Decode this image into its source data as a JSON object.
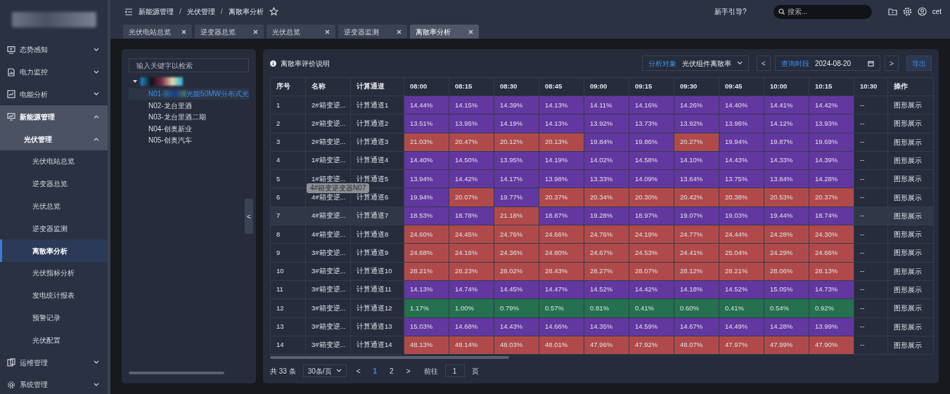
{
  "header": {
    "breadcrumb": [
      "新能源管理",
      "光伏管理",
      "离散率分析"
    ],
    "separator": "/",
    "guide": "新手引导?",
    "search": {
      "placeholder": "搜索..."
    },
    "user": "cet"
  },
  "tabs": [
    {
      "label": "光伏电站总览",
      "selected": false
    },
    {
      "label": "逆变器总览",
      "selected": false
    },
    {
      "label": "光伏总览",
      "selected": false
    },
    {
      "label": "逆变器监测",
      "selected": false
    },
    {
      "label": "离散率分析",
      "selected": true
    }
  ],
  "sidebar": {
    "items": [
      {
        "label": "态势感知",
        "expanded": false
      },
      {
        "label": "电力监控",
        "expanded": false
      },
      {
        "label": "电能分析",
        "expanded": false
      },
      {
        "label": "新能源管理",
        "expanded": true,
        "children": [
          {
            "label": "光伏管理",
            "expanded": true,
            "children": [
              {
                "label": "光伏电站总览",
                "selected": false
              },
              {
                "label": "逆变器总览",
                "selected": false
              },
              {
                "label": "光伏总览",
                "selected": false
              },
              {
                "label": "逆变器监测",
                "selected": false
              },
              {
                "label": "离散率分析",
                "selected": true
              },
              {
                "label": "光伏指标分析",
                "selected": false
              },
              {
                "label": "发电统计报表",
                "selected": false
              },
              {
                "label": "预警记录",
                "selected": false
              },
              {
                "label": "光伏配置",
                "selected": false
              }
            ]
          }
        ]
      },
      {
        "label": "运维管理",
        "expanded": false
      },
      {
        "label": "系统管理",
        "expanded": false
      }
    ]
  },
  "tree": {
    "search": {
      "placeholder": "输入关键字以检索"
    },
    "collapse": "<",
    "root": {
      "expanded": true,
      "children": [
        {
          "label": "N01-",
          "label_after_blur": "光能50MW分布式光",
          "selected": true
        },
        {
          "label": "N02-龙台里酒",
          "selected": false
        },
        {
          "label": "N03-龙台里酒二期",
          "selected": false
        },
        {
          "label": "N04-创奥新业",
          "selected": false
        },
        {
          "label": "N05-创奥汽车",
          "selected": false
        }
      ]
    }
  },
  "toolbar": {
    "info": "离散率评价说明",
    "object": {
      "label": "分析对象",
      "value": "光伏组件离散率"
    },
    "prev": "<",
    "period": {
      "label": "查询时段",
      "value": "2024-08-20"
    },
    "next": ">",
    "export": "导出"
  },
  "table": {
    "columns": [
      "序号",
      "名称",
      "计算通道",
      "08:00",
      "08:15",
      "08:30",
      "08:45",
      "09:00",
      "09:15",
      "09:30",
      "09:45",
      "10:00",
      "10:15",
      "10:30",
      "操作"
    ],
    "rows": [
      {
        "hovered": false,
        "cells": [
          {
            "kind": "text",
            "text": "1"
          },
          {
            "kind": "text",
            "text": "2#箱变逆..."
          },
          {
            "kind": "text",
            "text": "计算通道1"
          },
          {
            "kind": "value",
            "text": "14.44%",
            "color": "#6337a0"
          },
          {
            "kind": "value",
            "text": "14.15%",
            "color": "#6337a0"
          },
          {
            "kind": "value",
            "text": "14.39%",
            "color": "#6337a0"
          },
          {
            "kind": "value",
            "text": "14.13%",
            "color": "#6337a0"
          },
          {
            "kind": "value",
            "text": "14.11%",
            "color": "#6337a0"
          },
          {
            "kind": "value",
            "text": "14.16%",
            "color": "#6337a0"
          },
          {
            "kind": "value",
            "text": "14.26%",
            "color": "#6337a0"
          },
          {
            "kind": "value",
            "text": "14.40%",
            "color": "#6337a0"
          },
          {
            "kind": "value",
            "text": "14.41%",
            "color": "#6337a0"
          },
          {
            "kind": "value",
            "text": "14.42%",
            "color": "#6337a0"
          },
          {
            "kind": "text",
            "text": "--"
          },
          {
            "kind": "link",
            "text": "图形展示"
          }
        ]
      },
      {
        "hovered": false,
        "cells": [
          {
            "kind": "text",
            "text": "2"
          },
          {
            "kind": "text",
            "text": "2#箱变逆..."
          },
          {
            "kind": "text",
            "text": "计算通道2"
          },
          {
            "kind": "value",
            "text": "13.51%",
            "color": "#6337a0"
          },
          {
            "kind": "value",
            "text": "13.95%",
            "color": "#6337a0"
          },
          {
            "kind": "value",
            "text": "14.19%",
            "color": "#6337a0"
          },
          {
            "kind": "value",
            "text": "14.13%",
            "color": "#6337a0"
          },
          {
            "kind": "value",
            "text": "13.92%",
            "color": "#6337a0"
          },
          {
            "kind": "value",
            "text": "13.73%",
            "color": "#6337a0"
          },
          {
            "kind": "value",
            "text": "13.92%",
            "color": "#6337a0"
          },
          {
            "kind": "value",
            "text": "13.96%",
            "color": "#6337a0"
          },
          {
            "kind": "value",
            "text": "14.12%",
            "color": "#6337a0"
          },
          {
            "kind": "value",
            "text": "13.93%",
            "color": "#6337a0"
          },
          {
            "kind": "text",
            "text": "--"
          },
          {
            "kind": "link",
            "text": "图形展示"
          }
        ]
      },
      {
        "hovered": false,
        "cells": [
          {
            "kind": "text",
            "text": "3"
          },
          {
            "kind": "text",
            "text": "2#箱变逆..."
          },
          {
            "kind": "text",
            "text": "计算通道3"
          },
          {
            "kind": "value",
            "text": "21.03%",
            "color": "#b04a4a"
          },
          {
            "kind": "value",
            "text": "20.47%",
            "color": "#b04a4a"
          },
          {
            "kind": "value",
            "text": "20.12%",
            "color": "#b04a4a"
          },
          {
            "kind": "value",
            "text": "20.13%",
            "color": "#b04a4a"
          },
          {
            "kind": "value",
            "text": "19.84%",
            "color": "#6337a0"
          },
          {
            "kind": "value",
            "text": "19.86%",
            "color": "#6337a0"
          },
          {
            "kind": "value",
            "text": "20.27%",
            "color": "#b04a4a"
          },
          {
            "kind": "value",
            "text": "19.94%",
            "color": "#6337a0"
          },
          {
            "kind": "value",
            "text": "19.87%",
            "color": "#6337a0"
          },
          {
            "kind": "value",
            "text": "19.69%",
            "color": "#6337a0"
          },
          {
            "kind": "text",
            "text": "--"
          },
          {
            "kind": "link",
            "text": "图形展示"
          }
        ]
      },
      {
        "hovered": false,
        "cells": [
          {
            "kind": "text",
            "text": "4"
          },
          {
            "kind": "text",
            "text": "1#箱变逆..."
          },
          {
            "kind": "text",
            "text": "计算通道4"
          },
          {
            "kind": "value",
            "text": "14.40%",
            "color": "#6337a0"
          },
          {
            "kind": "value",
            "text": "14.50%",
            "color": "#6337a0"
          },
          {
            "kind": "value",
            "text": "13.95%",
            "color": "#6337a0"
          },
          {
            "kind": "value",
            "text": "14.19%",
            "color": "#6337a0"
          },
          {
            "kind": "value",
            "text": "14.02%",
            "color": "#6337a0"
          },
          {
            "kind": "value",
            "text": "14.58%",
            "color": "#6337a0"
          },
          {
            "kind": "value",
            "text": "14.10%",
            "color": "#6337a0"
          },
          {
            "kind": "value",
            "text": "14.43%",
            "color": "#6337a0"
          },
          {
            "kind": "value",
            "text": "14.33%",
            "color": "#6337a0"
          },
          {
            "kind": "value",
            "text": "14.39%",
            "color": "#6337a0"
          },
          {
            "kind": "text",
            "text": "--"
          },
          {
            "kind": "link",
            "text": "图形展示"
          }
        ]
      },
      {
        "hovered": false,
        "cells": [
          {
            "kind": "text",
            "text": "5"
          },
          {
            "kind": "text",
            "text": "1#箱变逆..."
          },
          {
            "kind": "text",
            "text": "计算通道5"
          },
          {
            "kind": "value",
            "text": "13.94%",
            "color": "#6337a0"
          },
          {
            "kind": "value",
            "text": "14.42%",
            "color": "#6337a0"
          },
          {
            "kind": "value",
            "text": "14.17%",
            "color": "#6337a0"
          },
          {
            "kind": "value",
            "text": "13.98%",
            "color": "#6337a0"
          },
          {
            "kind": "value",
            "text": "13.33%",
            "color": "#6337a0"
          },
          {
            "kind": "value",
            "text": "14.09%",
            "color": "#6337a0"
          },
          {
            "kind": "value",
            "text": "13.64%",
            "color": "#6337a0"
          },
          {
            "kind": "value",
            "text": "13.75%",
            "color": "#6337a0"
          },
          {
            "kind": "value",
            "text": "13.84%",
            "color": "#6337a0"
          },
          {
            "kind": "value",
            "text": "14.28%",
            "color": "#6337a0"
          },
          {
            "kind": "text",
            "text": "--"
          },
          {
            "kind": "link",
            "text": "图形展示"
          }
        ]
      },
      {
        "hovered": false,
        "tooltip": "4#箱变逆变器N07",
        "cells": [
          {
            "kind": "text",
            "text": "6"
          },
          {
            "kind": "text",
            "text": "4#箱变逆..."
          },
          {
            "kind": "text",
            "text": "计算通道6"
          },
          {
            "kind": "value",
            "text": "19.94%",
            "color": "#6337a0"
          },
          {
            "kind": "value",
            "text": "20.07%",
            "color": "#b04a4a"
          },
          {
            "kind": "value",
            "text": "19.77%",
            "color": "#6337a0"
          },
          {
            "kind": "value",
            "text": "20.37%",
            "color": "#b04a4a"
          },
          {
            "kind": "value",
            "text": "20.34%",
            "color": "#b04a4a"
          },
          {
            "kind": "value",
            "text": "20.30%",
            "color": "#b04a4a"
          },
          {
            "kind": "value",
            "text": "20.42%",
            "color": "#b04a4a"
          },
          {
            "kind": "value",
            "text": "20.38%",
            "color": "#b04a4a"
          },
          {
            "kind": "value",
            "text": "20.53%",
            "color": "#b04a4a"
          },
          {
            "kind": "value",
            "text": "20.37%",
            "color": "#b04a4a"
          },
          {
            "kind": "text",
            "text": "--"
          },
          {
            "kind": "link",
            "text": "图形展示"
          }
        ]
      },
      {
        "hovered": true,
        "cells": [
          {
            "kind": "text",
            "text": "7"
          },
          {
            "kind": "text",
            "text": "4#箱变逆..."
          },
          {
            "kind": "text",
            "text": "计算通道7"
          },
          {
            "kind": "value",
            "text": "18.53%",
            "color": "#6337a0"
          },
          {
            "kind": "value",
            "text": "18.78%",
            "color": "#6337a0"
          },
          {
            "kind": "value",
            "text": "21.18%",
            "color": "#b04a4a"
          },
          {
            "kind": "value",
            "text": "18.87%",
            "color": "#6337a0"
          },
          {
            "kind": "value",
            "text": "19.28%",
            "color": "#6337a0"
          },
          {
            "kind": "value",
            "text": "18.97%",
            "color": "#6337a0"
          },
          {
            "kind": "value",
            "text": "19.07%",
            "color": "#6337a0"
          },
          {
            "kind": "value",
            "text": "19.03%",
            "color": "#6337a0"
          },
          {
            "kind": "value",
            "text": "19.44%",
            "color": "#6337a0"
          },
          {
            "kind": "value",
            "text": "18.74%",
            "color": "#6337a0"
          },
          {
            "kind": "text",
            "text": "--"
          },
          {
            "kind": "link",
            "text": "图形展示"
          }
        ]
      },
      {
        "hovered": false,
        "cells": [
          {
            "kind": "text",
            "text": "8"
          },
          {
            "kind": "text",
            "text": "4#箱变逆..."
          },
          {
            "kind": "text",
            "text": "计算通道8"
          },
          {
            "kind": "value",
            "text": "24.60%",
            "color": "#b04a4a"
          },
          {
            "kind": "value",
            "text": "24.45%",
            "color": "#b04a4a"
          },
          {
            "kind": "value",
            "text": "24.76%",
            "color": "#b04a4a"
          },
          {
            "kind": "value",
            "text": "24.66%",
            "color": "#b04a4a"
          },
          {
            "kind": "value",
            "text": "24.76%",
            "color": "#b04a4a"
          },
          {
            "kind": "value",
            "text": "24.19%",
            "color": "#b04a4a"
          },
          {
            "kind": "value",
            "text": "24.77%",
            "color": "#b04a4a"
          },
          {
            "kind": "value",
            "text": "24.44%",
            "color": "#b04a4a"
          },
          {
            "kind": "value",
            "text": "24.28%",
            "color": "#b04a4a"
          },
          {
            "kind": "value",
            "text": "24.30%",
            "color": "#b04a4a"
          },
          {
            "kind": "text",
            "text": "--"
          },
          {
            "kind": "link",
            "text": "图形展示"
          }
        ]
      },
      {
        "hovered": false,
        "cells": [
          {
            "kind": "text",
            "text": "9"
          },
          {
            "kind": "text",
            "text": "3#箱变逆..."
          },
          {
            "kind": "text",
            "text": "计算通道9"
          },
          {
            "kind": "value",
            "text": "24.68%",
            "color": "#b04a4a"
          },
          {
            "kind": "value",
            "text": "24.16%",
            "color": "#b04a4a"
          },
          {
            "kind": "value",
            "text": "24.36%",
            "color": "#b04a4a"
          },
          {
            "kind": "value",
            "text": "24.80%",
            "color": "#b04a4a"
          },
          {
            "kind": "value",
            "text": "24.67%",
            "color": "#b04a4a"
          },
          {
            "kind": "value",
            "text": "24.53%",
            "color": "#b04a4a"
          },
          {
            "kind": "value",
            "text": "24.41%",
            "color": "#b04a4a"
          },
          {
            "kind": "value",
            "text": "25.04%",
            "color": "#b04a4a"
          },
          {
            "kind": "value",
            "text": "24.29%",
            "color": "#b04a4a"
          },
          {
            "kind": "value",
            "text": "24.66%",
            "color": "#b04a4a"
          },
          {
            "kind": "text",
            "text": "--"
          },
          {
            "kind": "link",
            "text": "图形展示"
          }
        ]
      },
      {
        "hovered": false,
        "cells": [
          {
            "kind": "text",
            "text": "10"
          },
          {
            "kind": "text",
            "text": "3#箱变逆..."
          },
          {
            "kind": "text",
            "text": "计算通道10"
          },
          {
            "kind": "value",
            "text": "28.21%",
            "color": "#b04a4a"
          },
          {
            "kind": "value",
            "text": "28.23%",
            "color": "#b04a4a"
          },
          {
            "kind": "value",
            "text": "28.02%",
            "color": "#b04a4a"
          },
          {
            "kind": "value",
            "text": "28.43%",
            "color": "#b04a4a"
          },
          {
            "kind": "value",
            "text": "28.27%",
            "color": "#b04a4a"
          },
          {
            "kind": "value",
            "text": "28.07%",
            "color": "#b04a4a"
          },
          {
            "kind": "value",
            "text": "28.12%",
            "color": "#b04a4a"
          },
          {
            "kind": "value",
            "text": "28.21%",
            "color": "#b04a4a"
          },
          {
            "kind": "value",
            "text": "28.06%",
            "color": "#b04a4a"
          },
          {
            "kind": "value",
            "text": "28.13%",
            "color": "#b04a4a"
          },
          {
            "kind": "text",
            "text": "--"
          },
          {
            "kind": "link",
            "text": "图形展示"
          }
        ]
      },
      {
        "hovered": false,
        "cells": [
          {
            "kind": "text",
            "text": "11"
          },
          {
            "kind": "text",
            "text": "3#箱变逆..."
          },
          {
            "kind": "text",
            "text": "计算通道11"
          },
          {
            "kind": "value",
            "text": "14.13%",
            "color": "#6337a0"
          },
          {
            "kind": "value",
            "text": "14.74%",
            "color": "#6337a0"
          },
          {
            "kind": "value",
            "text": "14.45%",
            "color": "#6337a0"
          },
          {
            "kind": "value",
            "text": "14.47%",
            "color": "#6337a0"
          },
          {
            "kind": "value",
            "text": "14.52%",
            "color": "#6337a0"
          },
          {
            "kind": "value",
            "text": "14.42%",
            "color": "#6337a0"
          },
          {
            "kind": "value",
            "text": "14.18%",
            "color": "#6337a0"
          },
          {
            "kind": "value",
            "text": "14.52%",
            "color": "#6337a0"
          },
          {
            "kind": "value",
            "text": "15.05%",
            "color": "#6337a0"
          },
          {
            "kind": "value",
            "text": "14.73%",
            "color": "#6337a0"
          },
          {
            "kind": "text",
            "text": "--"
          },
          {
            "kind": "link",
            "text": "图形展示"
          }
        ]
      },
      {
        "hovered": false,
        "cells": [
          {
            "kind": "text",
            "text": "12"
          },
          {
            "kind": "text",
            "text": "3#箱变逆..."
          },
          {
            "kind": "text",
            "text": "计算通道12"
          },
          {
            "kind": "value",
            "text": "1.17%",
            "color": "#24704f"
          },
          {
            "kind": "value",
            "text": "1.00%",
            "color": "#24704f"
          },
          {
            "kind": "value",
            "text": "0.79%",
            "color": "#24704f"
          },
          {
            "kind": "value",
            "text": "0.57%",
            "color": "#24704f"
          },
          {
            "kind": "value",
            "text": "0.81%",
            "color": "#24704f"
          },
          {
            "kind": "value",
            "text": "0.41%",
            "color": "#24704f"
          },
          {
            "kind": "value",
            "text": "0.60%",
            "color": "#24704f"
          },
          {
            "kind": "value",
            "text": "0.41%",
            "color": "#24704f"
          },
          {
            "kind": "value",
            "text": "0.54%",
            "color": "#24704f"
          },
          {
            "kind": "value",
            "text": "0.92%",
            "color": "#24704f"
          },
          {
            "kind": "text",
            "text": "--"
          },
          {
            "kind": "link",
            "text": "图形展示"
          }
        ]
      },
      {
        "hovered": false,
        "cells": [
          {
            "kind": "text",
            "text": "13"
          },
          {
            "kind": "text",
            "text": "3#箱变逆..."
          },
          {
            "kind": "text",
            "text": "计算通道13"
          },
          {
            "kind": "value",
            "text": "15.03%",
            "color": "#6337a0"
          },
          {
            "kind": "value",
            "text": "14.68%",
            "color": "#6337a0"
          },
          {
            "kind": "value",
            "text": "14.43%",
            "color": "#6337a0"
          },
          {
            "kind": "value",
            "text": "14.66%",
            "color": "#6337a0"
          },
          {
            "kind": "value",
            "text": "14.35%",
            "color": "#6337a0"
          },
          {
            "kind": "value",
            "text": "14.59%",
            "color": "#6337a0"
          },
          {
            "kind": "value",
            "text": "14.67%",
            "color": "#6337a0"
          },
          {
            "kind": "value",
            "text": "14.49%",
            "color": "#6337a0"
          },
          {
            "kind": "value",
            "text": "14.28%",
            "color": "#6337a0"
          },
          {
            "kind": "value",
            "text": "13.99%",
            "color": "#6337a0"
          },
          {
            "kind": "text",
            "text": "--"
          },
          {
            "kind": "link",
            "text": "图形展示"
          }
        ]
      },
      {
        "hovered": false,
        "cells": [
          {
            "kind": "text",
            "text": "14"
          },
          {
            "kind": "text",
            "text": "3#箱变逆..."
          },
          {
            "kind": "text",
            "text": "计算通道14"
          },
          {
            "kind": "value",
            "text": "48.13%",
            "color": "#b04a4a"
          },
          {
            "kind": "value",
            "text": "48.14%",
            "color": "#b04a4a"
          },
          {
            "kind": "value",
            "text": "48.03%",
            "color": "#b04a4a"
          },
          {
            "kind": "value",
            "text": "48.01%",
            "color": "#b04a4a"
          },
          {
            "kind": "value",
            "text": "47.96%",
            "color": "#b04a4a"
          },
          {
            "kind": "value",
            "text": "47.92%",
            "color": "#b04a4a"
          },
          {
            "kind": "value",
            "text": "48.07%",
            "color": "#b04a4a"
          },
          {
            "kind": "value",
            "text": "47.97%",
            "color": "#b04a4a"
          },
          {
            "kind": "value",
            "text": "47.99%",
            "color": "#b04a4a"
          },
          {
            "kind": "value",
            "text": "47.90%",
            "color": "#b04a4a"
          },
          {
            "kind": "text",
            "text": "--"
          },
          {
            "kind": "link",
            "text": "图形展示"
          }
        ]
      }
    ]
  },
  "pagination": {
    "total": "共 33 条",
    "page_size": "30条/页",
    "prev": "<",
    "pages": [
      {
        "label": "1",
        "selected": true
      },
      {
        "label": "2",
        "selected": false
      }
    ],
    "next": ">",
    "goto_label": "前往",
    "goto_value": "1",
    "goto_suffix": "页"
  }
}
